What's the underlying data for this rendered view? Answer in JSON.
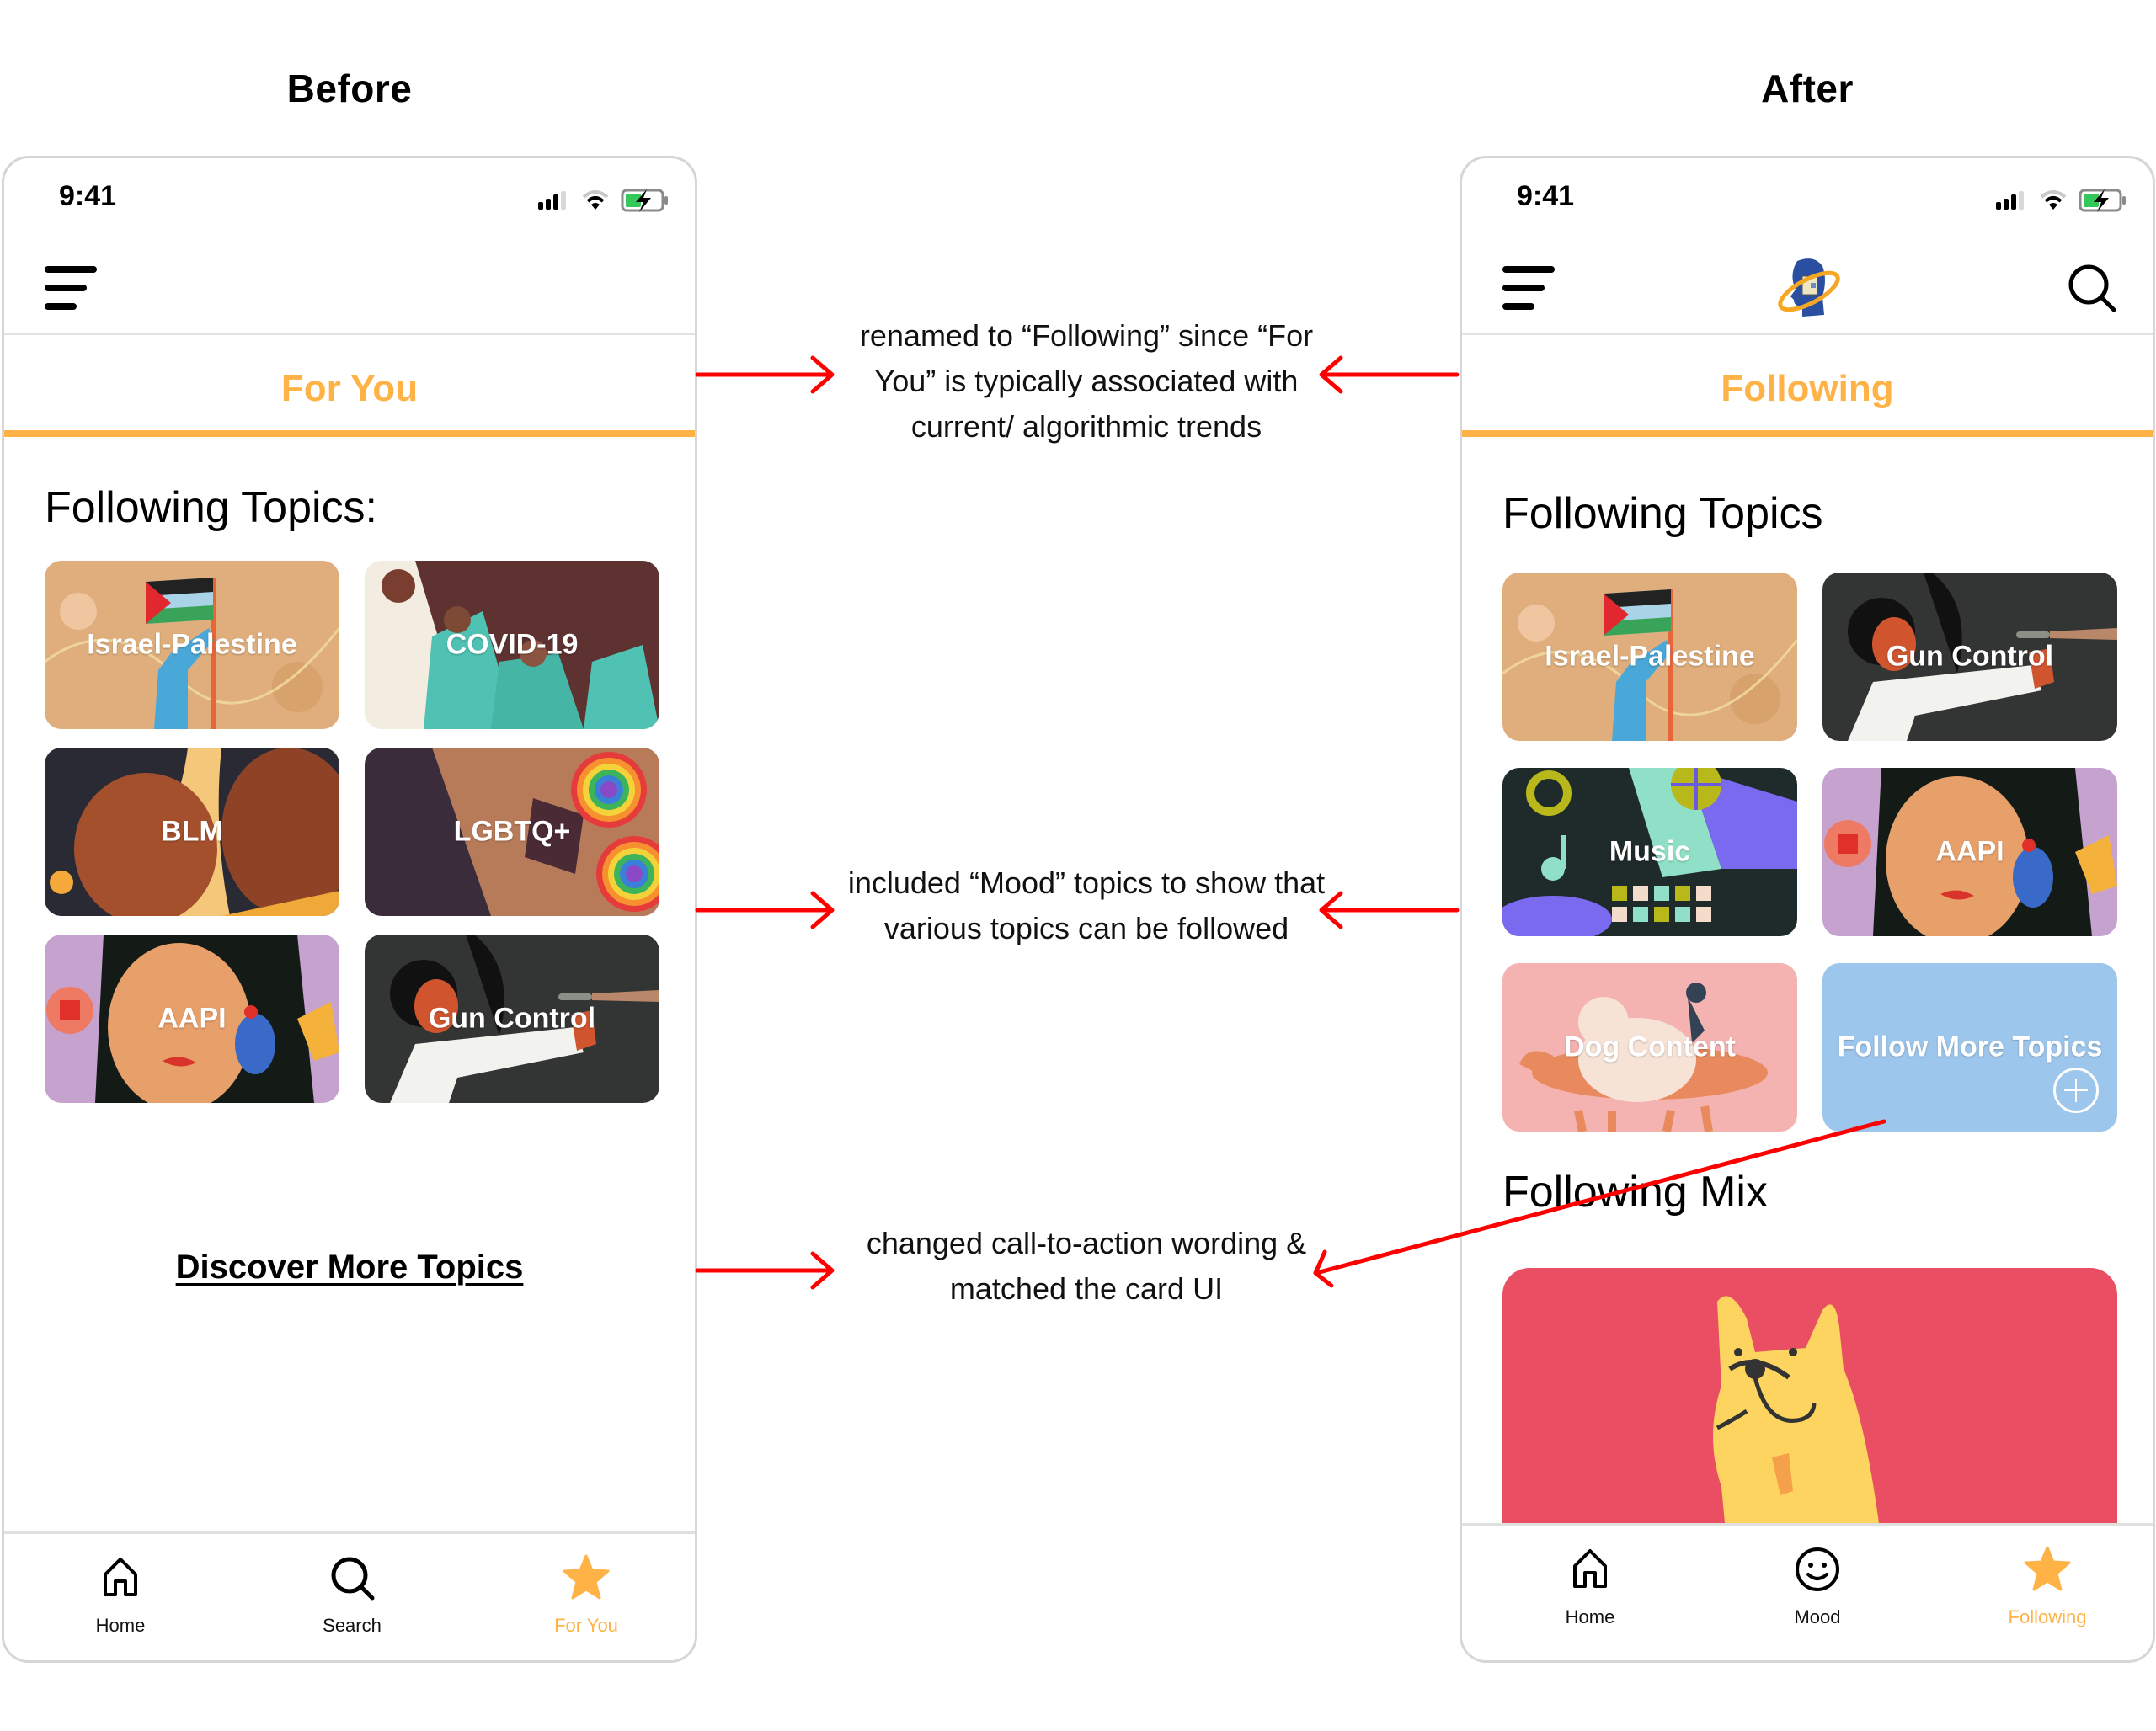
{
  "titles": {
    "before": "Before",
    "after": "After"
  },
  "colors": {
    "accent": "#ffb347",
    "annotation_arrow": "#ff0000",
    "follow_more_card": "#9dc6ec",
    "mix_card": "#e94e63"
  },
  "before": {
    "status": {
      "time": "9:41",
      "icons": [
        "cellular-signal-icon",
        "wifi-icon",
        "battery-charging-icon"
      ]
    },
    "header": {
      "menu_icon": "hamburger-menu-icon"
    },
    "tab": {
      "label": "For You"
    },
    "section_title": "Following Topics:",
    "topics": [
      {
        "label": "Israel-Palestine",
        "art": "flag-illustration"
      },
      {
        "label": "COVID-19",
        "art": "healthcare-workers-illustration"
      },
      {
        "label": "BLM",
        "art": "two-faces-illustration"
      },
      {
        "label": "LGBTQ+",
        "art": "rainbow-illustration"
      },
      {
        "label": "AAPI",
        "art": "woman-portrait-illustration"
      },
      {
        "label": "Gun Control",
        "art": "gun-control-illustration"
      }
    ],
    "cta": "Discover More Topics",
    "nav": [
      {
        "label": "Home",
        "icon": "home-icon",
        "active": false
      },
      {
        "label": "Search",
        "icon": "search-icon",
        "active": false
      },
      {
        "label": "For You",
        "icon": "star-icon",
        "active": true
      }
    ]
  },
  "after": {
    "status": {
      "time": "9:41",
      "icons": [
        "cellular-signal-icon",
        "wifi-icon",
        "battery-charging-icon"
      ]
    },
    "header": {
      "menu_icon": "hamburger-menu-icon",
      "logo": "app-logo",
      "search_icon": "search-icon"
    },
    "tab": {
      "label": "Following"
    },
    "section_title": "Following Topics",
    "topics": [
      {
        "label": "Israel-Palestine",
        "art": "flag-illustration"
      },
      {
        "label": "Gun Control",
        "art": "gun-control-illustration"
      },
      {
        "label": "Music",
        "art": "music-illustration"
      },
      {
        "label": "AAPI",
        "art": "woman-portrait-illustration"
      },
      {
        "label": "Dog Content",
        "art": "dogs-illustration"
      }
    ],
    "follow_more": {
      "label": "Follow More Topics",
      "icon": "plus-circle-icon"
    },
    "mix_title": "Following Mix",
    "mix_card_art": "french-bulldog-illustration",
    "nav": [
      {
        "label": "Home",
        "icon": "home-icon",
        "active": false
      },
      {
        "label": "Mood",
        "icon": "smiley-icon",
        "active": false
      },
      {
        "label": "Following",
        "icon": "star-icon",
        "active": true
      }
    ]
  },
  "annotations": [
    {
      "text": "renamed to “Following” since “For You” is typically associated with current/ algorithmic trends"
    },
    {
      "text": "included “Mood” topics to show that various topics can be followed"
    },
    {
      "text": "changed call-to-action wording & matched the card UI"
    }
  ]
}
